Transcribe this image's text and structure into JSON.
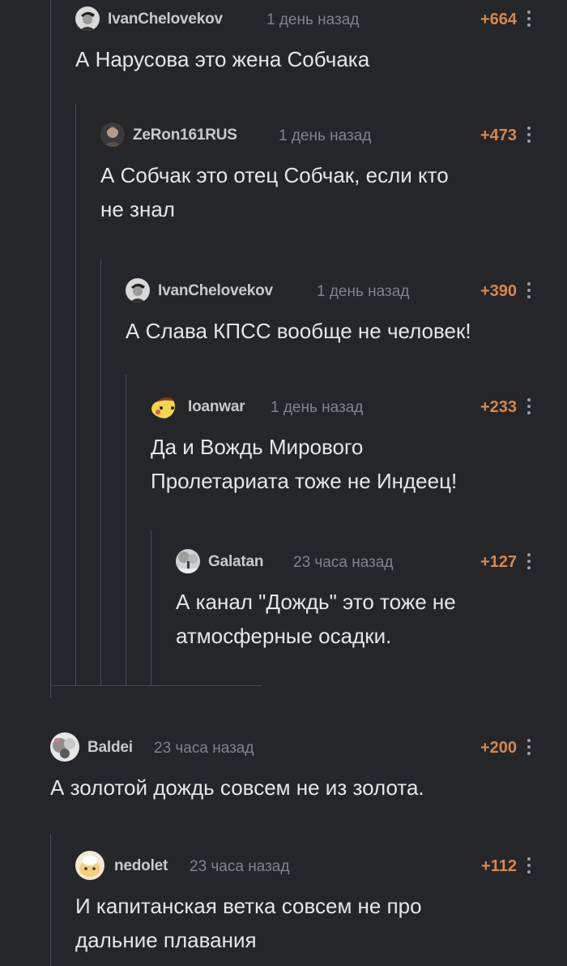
{
  "comments": [
    {
      "author": "IvanChelovekov",
      "time": "1 день назад",
      "rating": "+664",
      "lines": [
        "А Нарусова это жена Собчака"
      ]
    },
    {
      "author": "ZeRon161RUS",
      "time": "1 день назад",
      "rating": "+473",
      "lines": [
        "А Собчак это отец Собчак, если кто",
        "не знал"
      ]
    },
    {
      "author": "IvanChelovekov",
      "time": "1 день назад",
      "rating": "+390",
      "lines": [
        "А Слава КПСС вообще не человек!"
      ]
    },
    {
      "author": "Ioanwar",
      "time": "1 день назад",
      "rating": "+233",
      "lines": [
        "Да и Вождь Мирового",
        "Пролетариата тоже не Индеец!"
      ]
    },
    {
      "author": "Galatan",
      "time": "23 часа назад",
      "rating": "+127",
      "lines": [
        "А канал \"Дождь\" это тоже не",
        "атмосферные осадки."
      ]
    },
    {
      "author": "Baldei",
      "time": "23 часа назад",
      "rating": "+200",
      "lines": [
        "А золотой дождь совсем не из золота."
      ]
    },
    {
      "author": "nedolet",
      "time": "23 часа назад",
      "rating": "+112",
      "lines": [
        "И капитанская ветка совсем не про",
        "дальние плавания"
      ]
    }
  ],
  "colors": {
    "background": "#24262a",
    "rating": "#d9874a",
    "thread_line": "#4a4c51"
  }
}
